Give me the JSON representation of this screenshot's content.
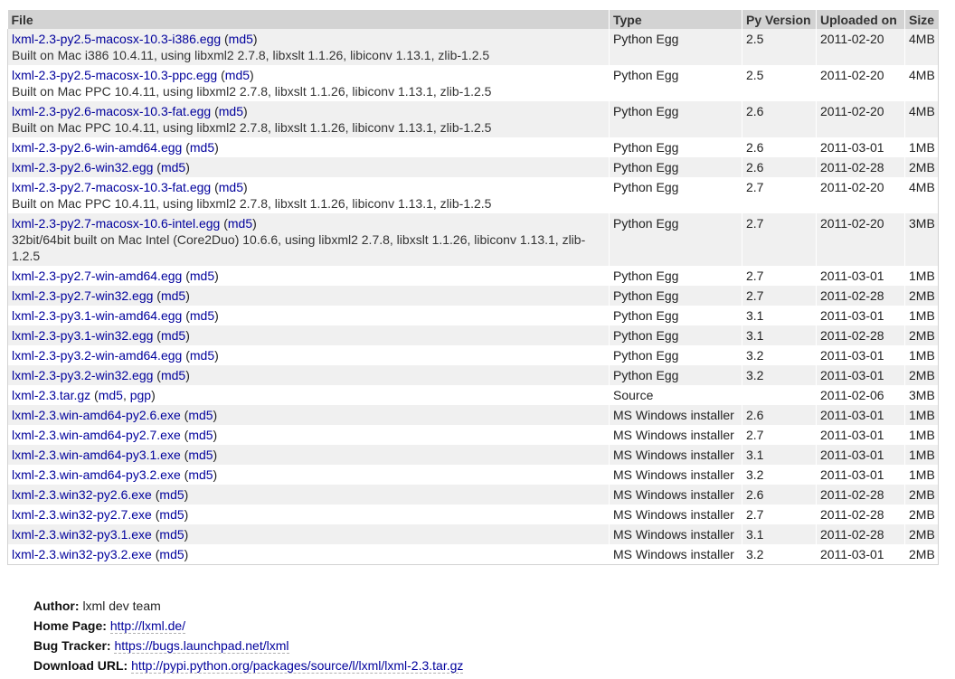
{
  "table": {
    "headers": {
      "file": "File",
      "type": "Type",
      "py_version": "Py Version",
      "uploaded_on": "Uploaded on",
      "size": "Size"
    },
    "md5_label": "md5",
    "pgp_label": "pgp",
    "rows": [
      {
        "file": "lxml-2.3-py2.5-macosx-10.3-i386.egg",
        "desc": "Built on Mac i386 10.4.11, using libxml2 2.7.8, libxslt 1.1.26, libiconv 1.13.1, zlib-1.2.5",
        "type": "Python Egg",
        "py": "2.5",
        "date": "2011-02-20",
        "size": "4MB"
      },
      {
        "file": "lxml-2.3-py2.5-macosx-10.3-ppc.egg",
        "desc": "Built on Mac PPC 10.4.11, using libxml2 2.7.8, libxslt 1.1.26, libiconv 1.13.1, zlib-1.2.5",
        "type": "Python Egg",
        "py": "2.5",
        "date": "2011-02-20",
        "size": "4MB"
      },
      {
        "file": "lxml-2.3-py2.6-macosx-10.3-fat.egg",
        "desc": "Built on Mac PPC 10.4.11, using libxml2 2.7.8, libxslt 1.1.26, libiconv 1.13.1, zlib-1.2.5",
        "type": "Python Egg",
        "py": "2.6",
        "date": "2011-02-20",
        "size": "4MB"
      },
      {
        "file": "lxml-2.3-py2.6-win-amd64.egg",
        "desc": "",
        "type": "Python Egg",
        "py": "2.6",
        "date": "2011-03-01",
        "size": "1MB"
      },
      {
        "file": "lxml-2.3-py2.6-win32.egg",
        "desc": "",
        "type": "Python Egg",
        "py": "2.6",
        "date": "2011-02-28",
        "size": "2MB"
      },
      {
        "file": "lxml-2.3-py2.7-macosx-10.3-fat.egg",
        "desc": "Built on Mac PPC 10.4.11, using libxml2 2.7.8, libxslt 1.1.26, libiconv 1.13.1, zlib-1.2.5",
        "type": "Python Egg",
        "py": "2.7",
        "date": "2011-02-20",
        "size": "4MB"
      },
      {
        "file": "lxml-2.3-py2.7-macosx-10.6-intel.egg",
        "desc": "32bit/64bit built on Mac Intel (Core2Duo) 10.6.6, using libxml2 2.7.8, libxslt 1.1.26, libiconv 1.13.1, zlib-1.2.5",
        "type": "Python Egg",
        "py": "2.7",
        "date": "2011-02-20",
        "size": "3MB"
      },
      {
        "file": "lxml-2.3-py2.7-win-amd64.egg",
        "desc": "",
        "type": "Python Egg",
        "py": "2.7",
        "date": "2011-03-01",
        "size": "1MB"
      },
      {
        "file": "lxml-2.3-py2.7-win32.egg",
        "desc": "",
        "type": "Python Egg",
        "py": "2.7",
        "date": "2011-02-28",
        "size": "2MB"
      },
      {
        "file": "lxml-2.3-py3.1-win-amd64.egg",
        "desc": "",
        "type": "Python Egg",
        "py": "3.1",
        "date": "2011-03-01",
        "size": "1MB"
      },
      {
        "file": "lxml-2.3-py3.1-win32.egg",
        "desc": "",
        "type": "Python Egg",
        "py": "3.1",
        "date": "2011-02-28",
        "size": "2MB"
      },
      {
        "file": "lxml-2.3-py3.2-win-amd64.egg",
        "desc": "",
        "type": "Python Egg",
        "py": "3.2",
        "date": "2011-03-01",
        "size": "1MB"
      },
      {
        "file": "lxml-2.3-py3.2-win32.egg",
        "desc": "",
        "type": "Python Egg",
        "py": "3.2",
        "date": "2011-03-01",
        "size": "2MB"
      },
      {
        "file": "lxml-2.3.tar.gz",
        "desc": "",
        "type": "Source",
        "py": "",
        "date": "2011-02-06",
        "size": "3MB",
        "pgp": true
      },
      {
        "file": "lxml-2.3.win-amd64-py2.6.exe",
        "desc": "",
        "type": "MS Windows installer",
        "py": "2.6",
        "date": "2011-03-01",
        "size": "1MB"
      },
      {
        "file": "lxml-2.3.win-amd64-py2.7.exe",
        "desc": "",
        "type": "MS Windows installer",
        "py": "2.7",
        "date": "2011-03-01",
        "size": "1MB"
      },
      {
        "file": "lxml-2.3.win-amd64-py3.1.exe",
        "desc": "",
        "type": "MS Windows installer",
        "py": "3.1",
        "date": "2011-03-01",
        "size": "1MB"
      },
      {
        "file": "lxml-2.3.win-amd64-py3.2.exe",
        "desc": "",
        "type": "MS Windows installer",
        "py": "3.2",
        "date": "2011-03-01",
        "size": "1MB"
      },
      {
        "file": "lxml-2.3.win32-py2.6.exe",
        "desc": "",
        "type": "MS Windows installer",
        "py": "2.6",
        "date": "2011-02-28",
        "size": "2MB"
      },
      {
        "file": "lxml-2.3.win32-py2.7.exe",
        "desc": "",
        "type": "MS Windows installer",
        "py": "2.7",
        "date": "2011-02-28",
        "size": "2MB"
      },
      {
        "file": "lxml-2.3.win32-py3.1.exe",
        "desc": "",
        "type": "MS Windows installer",
        "py": "3.1",
        "date": "2011-02-28",
        "size": "2MB"
      },
      {
        "file": "lxml-2.3.win32-py3.2.exe",
        "desc": "",
        "type": "MS Windows installer",
        "py": "3.2",
        "date": "2011-03-01",
        "size": "2MB"
      }
    ]
  },
  "meta": {
    "author_label": "Author:",
    "author_value": "lxml dev team",
    "homepage_label": "Home Page:",
    "homepage_value": "http://lxml.de/",
    "bugtracker_label": "Bug Tracker:",
    "bugtracker_value": "https://bugs.launchpad.net/lxml",
    "download_label": "Download URL:",
    "download_value": "http://pypi.python.org/packages/source/l/lxml/lxml-2.3.tar.gz"
  }
}
